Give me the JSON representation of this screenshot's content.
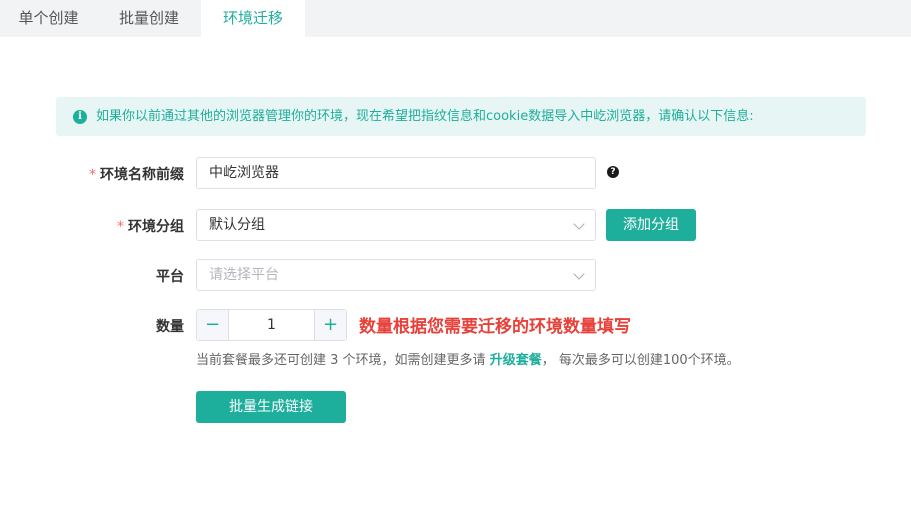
{
  "tabs": {
    "single": "单个创建",
    "batch": "批量创建",
    "migrate": "环境迁移"
  },
  "alert": {
    "icon": "info-icon",
    "text": "如果你以前通过其他的浏览器管理你的环境，现在希望把指纹信息和cookie数据导入中屹浏览器，请确认以下信息:"
  },
  "form": {
    "name_prefix": {
      "label": "环境名称前缀",
      "required": "*",
      "value": "中屹浏览器",
      "help_icon": "question-icon"
    },
    "group": {
      "label": "环境分组",
      "required": "*",
      "value": "默认分组",
      "add_button": "添加分组"
    },
    "platform": {
      "label": "平台",
      "placeholder": "请选择平台"
    },
    "quantity": {
      "label": "数量",
      "minus": "−",
      "value": "1",
      "plus": "+",
      "annotation": "数量根据您需要迁移的环境数量填写",
      "hint_before": "当前套餐最多还可创建 3 个环境，如需创建更多请",
      "hint_link": "升级套餐",
      "hint_after": "，  每次最多可以创建100个环境。"
    },
    "submit": "批量生成链接"
  },
  "colors": {
    "accent": "#1dae9c",
    "annotation": "#e8413a",
    "required": "#f56c6c"
  }
}
